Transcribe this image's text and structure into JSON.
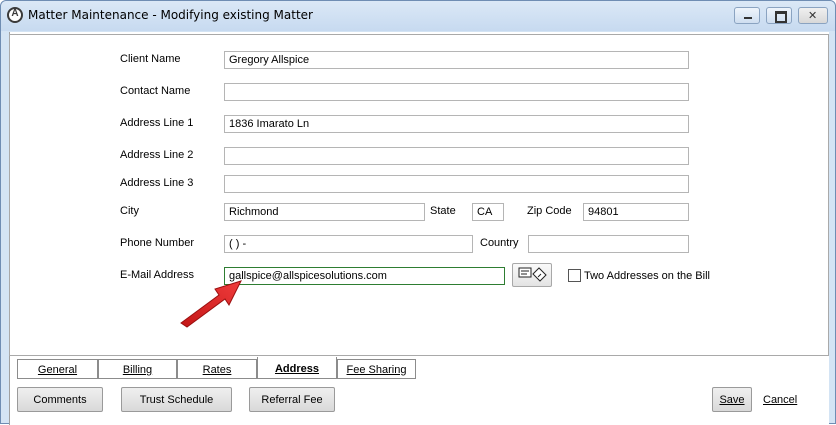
{
  "window": {
    "title": "Matter Maintenance - Modifying existing Matter"
  },
  "form": {
    "client_name_label": "Client Name",
    "client_name_value": "Gregory Allspice",
    "contact_name_label": "Contact Name",
    "contact_name_value": "",
    "address1_label": "Address Line 1",
    "address1_value": "1836 Imarato Ln",
    "address2_label": "Address Line 2",
    "address2_value": "",
    "address3_label": "Address Line 3",
    "address3_value": "",
    "city_label": "City",
    "city_value": "Richmond",
    "state_label": "State",
    "state_value": "CA",
    "zip_label": "Zip Code",
    "zip_value": "94801",
    "phone_label": "Phone Number",
    "phone_value": "(  )   -",
    "country_label": "Country",
    "country_value": "",
    "email_label": "E-Mail Address",
    "email_value": "gallspice@allspicesolutions.com",
    "two_addresses_label": "Two Addresses on the Bill",
    "two_addresses_checked": false
  },
  "tabs": [
    {
      "label": "General",
      "active": false
    },
    {
      "label": "Billing",
      "active": false
    },
    {
      "label": "Rates",
      "active": false
    },
    {
      "label": "Address",
      "active": true
    },
    {
      "label": "Fee Sharing",
      "active": false
    }
  ],
  "buttons": {
    "comments": "Comments",
    "trust_schedule": "Trust Schedule",
    "referral_fee": "Referral Fee",
    "save": "Save",
    "cancel": "Cancel"
  },
  "icons": {
    "app": "app-logo-icon",
    "card": "address-card-icon",
    "arrow": "red-arrow-annotation"
  },
  "colors": {
    "email_border": "#2e7d32",
    "arrow": "#e02020"
  }
}
